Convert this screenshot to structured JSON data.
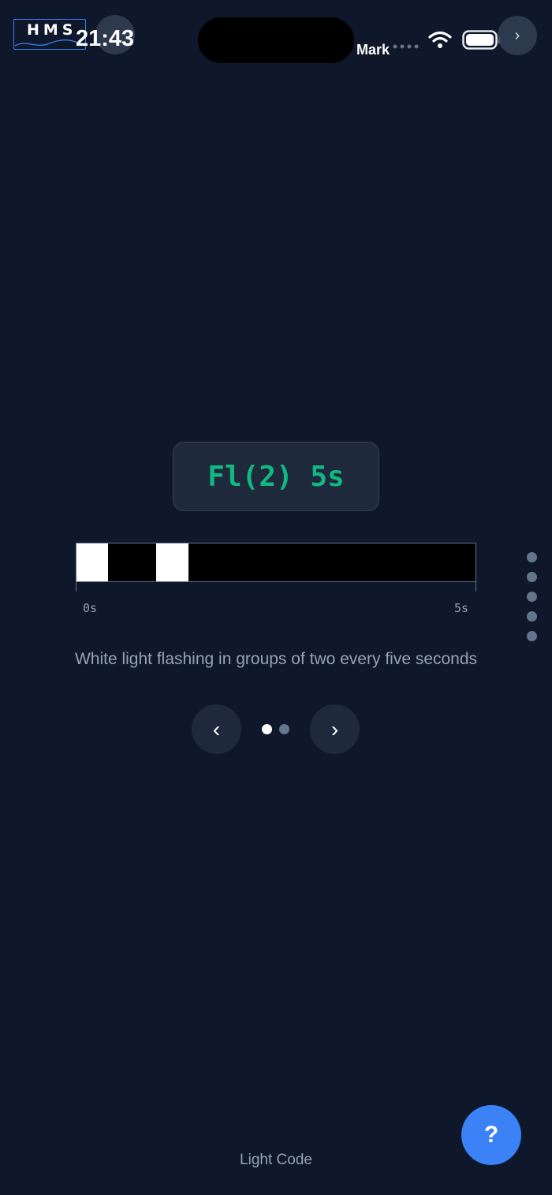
{
  "status_bar": {
    "logo_text": "HMS",
    "time": "21:43",
    "carrier": "Mark",
    "right_button_glyph": "›"
  },
  "light": {
    "code": "Fl(2) 5s",
    "description": "White light flashing in groups of two every five seconds",
    "period_seconds": 5,
    "flashes": [
      {
        "start": 0,
        "end": 0.4
      },
      {
        "start": 1.0,
        "end": 1.4
      }
    ],
    "flash_color": "#ffffff",
    "eclipse_color": "#000000",
    "axis": {
      "start_label": "0s",
      "end_label": "5s"
    }
  },
  "pager": {
    "prev_glyph": "‹",
    "next_glyph": "›",
    "pages": 2,
    "active_page": 1
  },
  "side_nav": {
    "count": 5
  },
  "help_button": {
    "label": "?"
  },
  "footer": {
    "label": "Light Code"
  },
  "colors": {
    "background": "#0f172a",
    "accent": "#10b981",
    "primary": "#3b82f6"
  }
}
